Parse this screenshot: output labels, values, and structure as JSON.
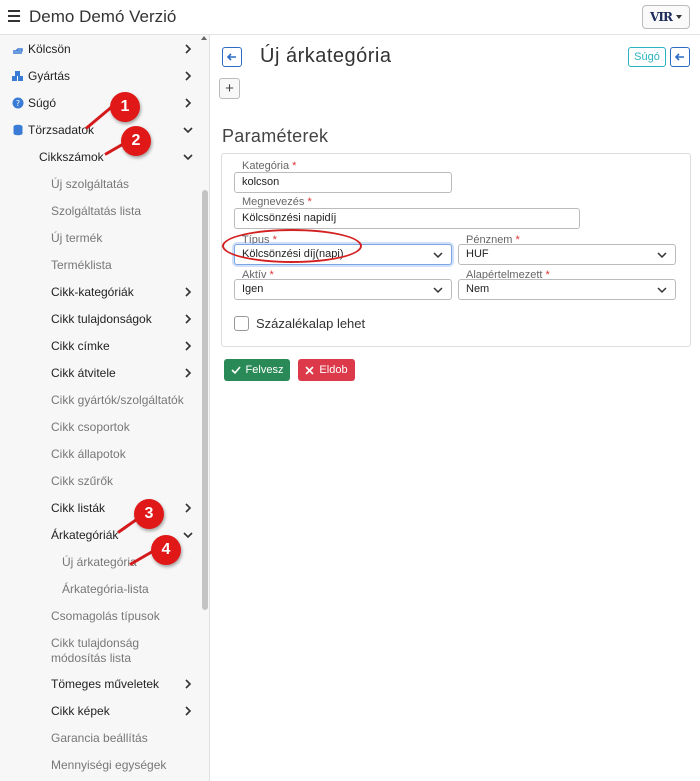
{
  "app": {
    "title": "Demo Demó Verzió",
    "logo_text": "VIR"
  },
  "sidebar": {
    "items": [
      {
        "label": "Kölcsön",
        "icon": "hand-icon"
      },
      {
        "label": "Gyártás",
        "icon": "cubes-icon"
      },
      {
        "label": "Súgó",
        "icon": "question-circle-icon"
      },
      {
        "label": "Törzsadatok",
        "icon": "database-icon"
      },
      {
        "label": "Cikkszámok"
      },
      {
        "label": "Új szolgáltatás"
      },
      {
        "label": "Szolgáltatás lista"
      },
      {
        "label": "Új termék"
      },
      {
        "label": "Terméklista"
      },
      {
        "label": "Cikk-kategóriák"
      },
      {
        "label": "Cikk tulajdonságok"
      },
      {
        "label": "Cikk címke"
      },
      {
        "label": "Cikk átvitele"
      },
      {
        "label": "Cikk gyártók/szolgáltatók"
      },
      {
        "label": "Cikk csoportok"
      },
      {
        "label": "Cikk állapotok"
      },
      {
        "label": "Cikk szűrők"
      },
      {
        "label": "Cikk listák"
      },
      {
        "label": "Árkategóriák"
      },
      {
        "label": "Új árkategória"
      },
      {
        "label": "Árkategória-lista"
      },
      {
        "label": "Csomagolás típusok"
      },
      {
        "label": "Cikk tulajdonság"
      },
      {
        "label": "módosítás lista"
      },
      {
        "label": "Tömeges műveletek"
      },
      {
        "label": "Cikk képek"
      },
      {
        "label": "Garancia beállítás"
      },
      {
        "label": "Mennyiségi egységek"
      }
    ]
  },
  "page": {
    "title": "Új árkategória",
    "help_label": "Súgó",
    "plus_label": "+",
    "section_title": "Paraméterek"
  },
  "form": {
    "kategoria_label": "Kategória",
    "kategoria_value": "kolcson",
    "megnevezes_label": "Megnevezés",
    "megnevezes_value": "Kölcsönzési napidíj",
    "tipus_label": "Típus",
    "tipus_value": "Kölcsönzési díj(napi)",
    "penznem_label": "Pénznem",
    "penznem_value": "HUF",
    "aktiv_label": "Aktív",
    "aktiv_value": "Igen",
    "alapertelmezett_label": "Alapértelmezett",
    "alapertelmezett_value": "Nem",
    "required_mark": "*",
    "checkbox_label": "Százalékalap lehet",
    "checkbox_checked": false
  },
  "buttons": {
    "save": "Felvesz",
    "cancel": "Eldob"
  },
  "annotations": [
    "1",
    "2",
    "3",
    "4"
  ],
  "colors": {
    "accent": "#2a6cc4",
    "save": "#2a8a57",
    "cancel": "#dc3a4a",
    "annotation": "#e01818"
  }
}
